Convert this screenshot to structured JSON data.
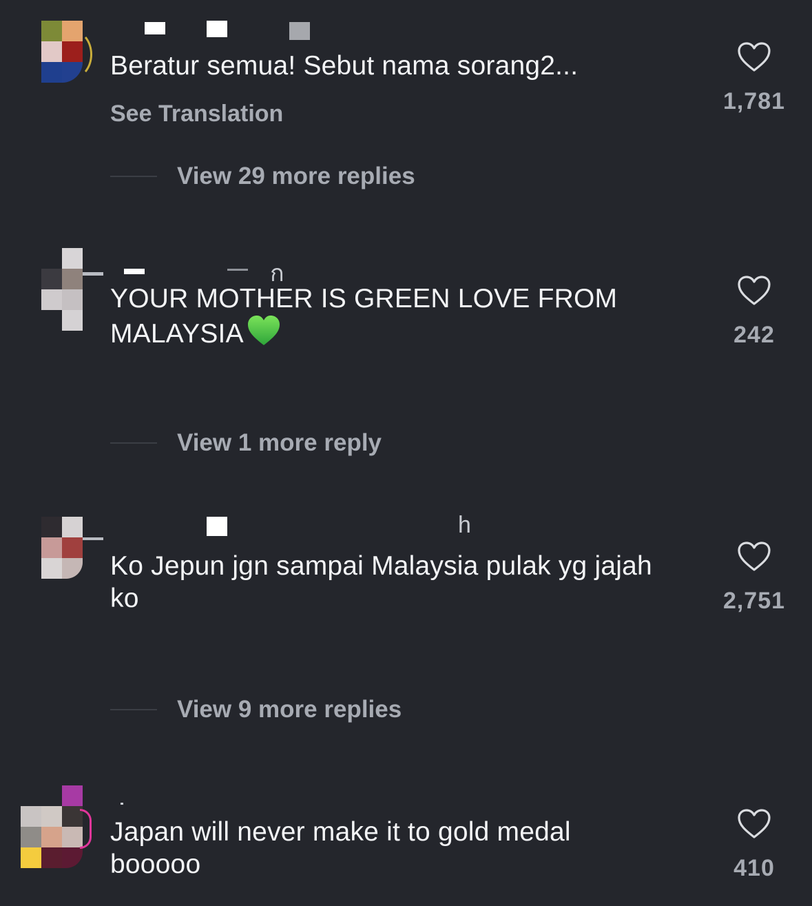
{
  "comments": [
    {
      "text": "Beratur semua! Sebut nama sorang2...",
      "see_translation": "See Translation",
      "likes": "1,781",
      "replies_label": "View 29 more replies"
    },
    {
      "text": "YOUR MOTHER IS GREEN LOVE FROM MALAYSIA",
      "emoji": "green-heart-emoji",
      "likes": "242",
      "replies_label": "View 1 more reply"
    },
    {
      "text": "Ko Jepun jgn sampai Malaysia pulak yg jajah ko",
      "likes": "2,751",
      "replies_label": "View 9 more replies"
    },
    {
      "text": "Japan will never make it to gold medal booooo",
      "likes": "410"
    }
  ],
  "colors": {
    "background": "#24262c",
    "primary_text": "#f3f4f6",
    "secondary_text": "#a7abb3",
    "green_heart": "#3ec43a"
  },
  "icons": {
    "like": "heart-outline-icon"
  }
}
